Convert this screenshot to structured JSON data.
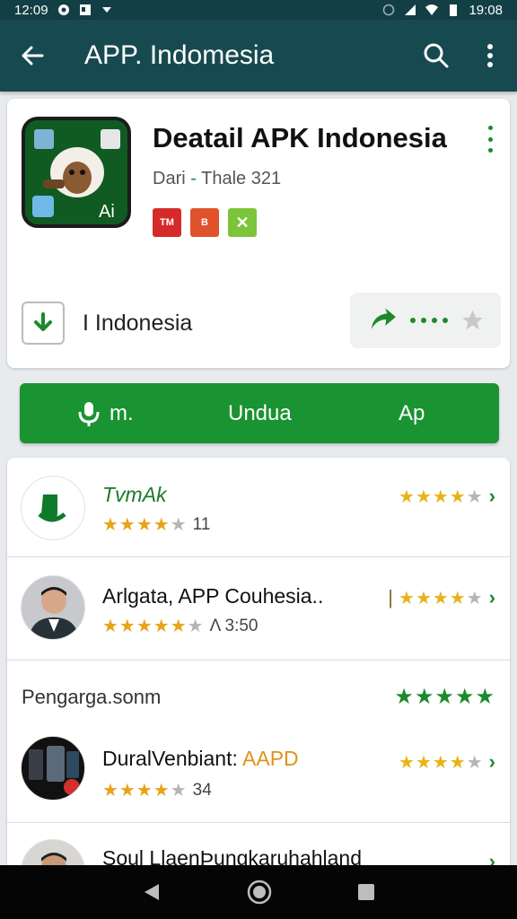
{
  "status": {
    "time_left": "12:09",
    "time_right": "19:08"
  },
  "appbar": {
    "title": "APP. Indomesia",
    "back_icon": "arrow-left-icon",
    "search_icon": "search-icon",
    "menu_icon": "more-vert-icon"
  },
  "detail": {
    "name": "Deatail APK Indonesia",
    "dev_prefix": "Dari",
    "dev_dash": "-",
    "dev_name": "Thale 321",
    "badges": [
      "TM",
      "B",
      "✕"
    ],
    "install_label": "I Indonesia"
  },
  "action_bar": {
    "left_label": "m.",
    "center_label": "Undua",
    "right_label": "Ap"
  },
  "list": {
    "rows": [
      {
        "title": "TvmAk",
        "count": "11",
        "stars": 4
      },
      {
        "title": "Arlgata, APP Couhesia..",
        "count": "Λ 3:50",
        "stars": 5
      },
      {
        "section": "Pengarga.sonm"
      },
      {
        "title_main": "DuralVenbiant:",
        "title_accent": "AAPD",
        "count": "34",
        "stars": 4
      },
      {
        "title": "Soul LlaenÞungkaruhahland"
      }
    ]
  },
  "colors": {
    "appbar": "#174a50",
    "accent": "#1a9332",
    "star": "#e8a318"
  }
}
